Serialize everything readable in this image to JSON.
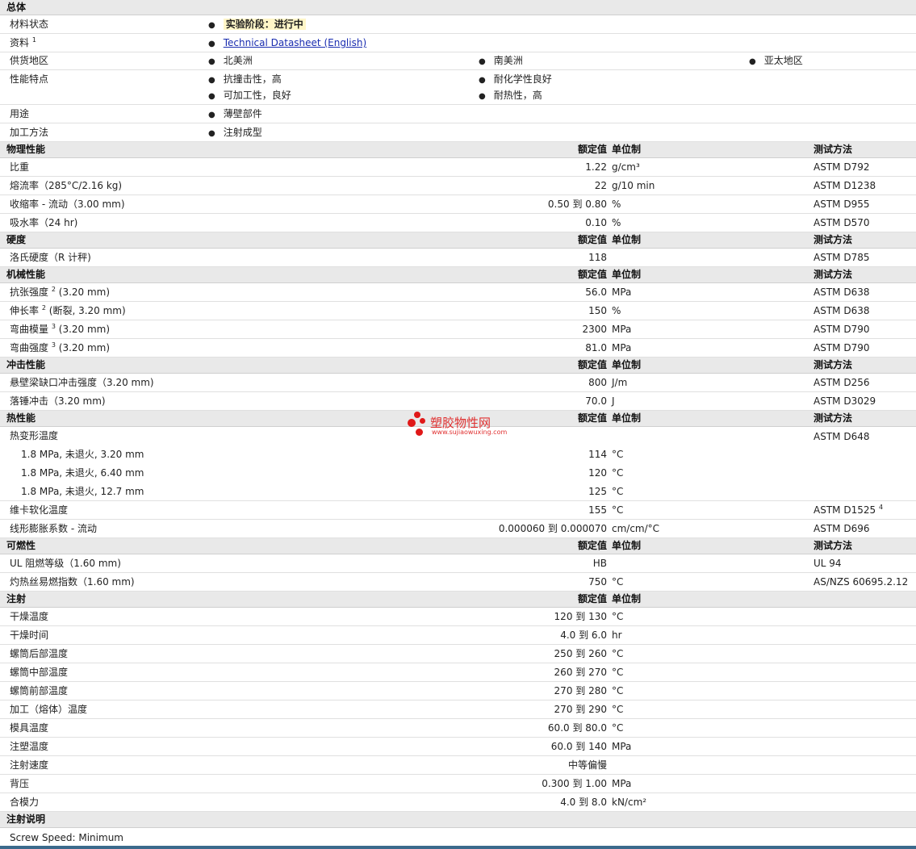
{
  "general": {
    "title": "总体",
    "status_label": "材料状态",
    "status_value": "实验阶段：进行中",
    "source_label": "资料",
    "source_sup": "1",
    "source_link": "Technical Datasheet (English)",
    "region_label": "供货地区",
    "regions": [
      "北美洲",
      "南美洲",
      "亚太地区"
    ],
    "features_label": "性能特点",
    "features": [
      "抗撞击性，高",
      "耐化学性良好",
      "可加工性，良好",
      "耐热性，高"
    ],
    "uses_label": "用途",
    "uses": [
      "薄壁部件"
    ],
    "process_label": "加工方法",
    "process": [
      "注射成型"
    ]
  },
  "col_headers": {
    "value": "额定值",
    "unit": "单位制",
    "method": "测试方法"
  },
  "sections": {
    "physical": "物理性能",
    "hardness": "硬度",
    "mechanical": "机械性能",
    "impact": "冲击性能",
    "thermal": "热性能",
    "flammability": "可燃性",
    "injection": "注射",
    "injection_notes": "注射说明"
  },
  "physical": [
    {
      "label": "比重",
      "value": "1.22",
      "unit": "g/cm³",
      "method": "ASTM D792"
    },
    {
      "label": "熔流率（285°C/2.16 kg)",
      "value": "22",
      "unit": "g/10 min",
      "method": "ASTM D1238"
    },
    {
      "label": "收缩率 - 流动（3.00 mm)",
      "value": "0.50 到  0.80",
      "unit": "%",
      "method": "ASTM D955"
    },
    {
      "label": "吸水率（24 hr)",
      "value": "0.10",
      "unit": "%",
      "method": "ASTM D570"
    }
  ],
  "hardness": [
    {
      "label": "洛氏硬度（R 计秤)",
      "value": "118",
      "unit": "",
      "method": "ASTM D785"
    }
  ],
  "mechanical": [
    {
      "label": "抗张强度",
      "sup": "2",
      "tail": "(3.20 mm)",
      "value": "56.0",
      "unit": "MPa",
      "method": "ASTM D638"
    },
    {
      "label": "伸长率",
      "sup": "2",
      "tail": "(断裂, 3.20 mm)",
      "value": "150",
      "unit": "%",
      "method": "ASTM D638"
    },
    {
      "label": "弯曲模量",
      "sup": "3",
      "tail": "(3.20 mm)",
      "value": "2300",
      "unit": "MPa",
      "method": "ASTM D790"
    },
    {
      "label": "弯曲强度",
      "sup": "3",
      "tail": "(3.20 mm)",
      "value": "81.0",
      "unit": "MPa",
      "method": "ASTM D790"
    }
  ],
  "impact": [
    {
      "label": "悬壁梁缺口冲击强度（3.20 mm)",
      "value": "800",
      "unit": "J/m",
      "method": "ASTM D256"
    },
    {
      "label": "落锤冲击（3.20 mm)",
      "value": "70.0",
      "unit": "J",
      "method": "ASTM D3029"
    }
  ],
  "thermal": {
    "hdt_label": "热变形温度",
    "hdt_method": "ASTM D648",
    "hdt_rows": [
      {
        "label": "1.8 MPa, 未退火, 3.20 mm",
        "value": "114",
        "unit": "°C"
      },
      {
        "label": "1.8 MPa, 未退火, 6.40 mm",
        "value": "120",
        "unit": "°C"
      },
      {
        "label": "1.8 MPa, 未退火, 12.7 mm",
        "value": "125",
        "unit": "°C"
      }
    ],
    "vicat": {
      "label": "维卡软化温度",
      "value": "155",
      "unit": "°C",
      "method": "ASTM D1525",
      "sup": "4"
    },
    "clte": {
      "label": "线形膨胀系数 - 流动",
      "value": "0.000060 到  0.000070",
      "unit": "cm/cm/°C",
      "method": "ASTM D696"
    }
  },
  "flammability": [
    {
      "label": "UL 阻燃等级（1.60 mm)",
      "value": "HB",
      "unit": "",
      "method": "UL 94"
    },
    {
      "label": "灼热丝易燃指数（1.60 mm)",
      "value": "750",
      "unit": "°C",
      "method": "AS/NZS 60695.2.12"
    }
  ],
  "injection": [
    {
      "label": "干燥温度",
      "value": "120 到  130",
      "unit": "°C"
    },
    {
      "label": "干燥时间",
      "value": "4.0 到  6.0",
      "unit": "hr"
    },
    {
      "label": "螺筒后部温度",
      "value": "250 到  260",
      "unit": "°C"
    },
    {
      "label": "螺筒中部温度",
      "value": "260 到  270",
      "unit": "°C"
    },
    {
      "label": "螺筒前部温度",
      "value": "270 到  280",
      "unit": "°C"
    },
    {
      "label": "加工（熔体）温度",
      "value": "270 到  290",
      "unit": "°C"
    },
    {
      "label": "模具温度",
      "value": "60.0 到  80.0",
      "unit": "°C"
    },
    {
      "label": "注塑温度",
      "value": "60.0 到  140",
      "unit": "MPa"
    },
    {
      "label": "注射速度",
      "value": "中等偏慢",
      "unit": ""
    },
    {
      "label": "背压",
      "value": "0.300 到  1.00",
      "unit": "MPa"
    },
    {
      "label": "合模力",
      "value": "4.0 到  8.0",
      "unit": "kN/cm²"
    }
  ],
  "notes": [
    "Screw Speed: Minimum"
  ],
  "watermark": {
    "text": "塑胶物性网",
    "url": "www.sujiaowuxing.com"
  }
}
